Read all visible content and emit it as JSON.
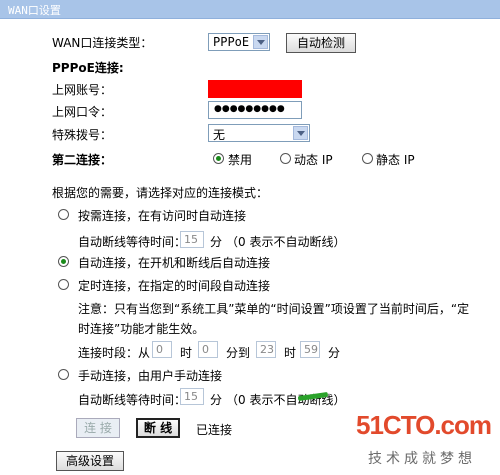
{
  "window": {
    "title": "WAN口设置"
  },
  "wan_type": {
    "label": "WAN口连接类型：",
    "value": "PPPoE",
    "detect_button": "自动检测"
  },
  "pppoe": {
    "section_label": "PPPoE连接:",
    "account_label": "上网账号：",
    "password_label": "上网口令：",
    "password_mask": "●●●●●●●●●",
    "dial_label": "特殊拨号：",
    "dial_value": "无"
  },
  "second": {
    "label": "第二连接：",
    "options": [
      "禁用",
      "动态 IP",
      "静态 IP"
    ],
    "selected_index": 0
  },
  "mode": {
    "prompt": "根据您的需要，请选择对应的连接模式：",
    "ondemand_label": "按需连接，在有访问时自动连接",
    "ondemand_idle_prefix": "自动断线等待时间：",
    "ondemand_idle_value": "15",
    "ondemand_idle_unit": "分",
    "ondemand_idle_note": "（0 表示不自动断线）",
    "auto_label": "自动连接，在开机和断线后自动连接",
    "timed_label": "定时连接，在指定的时间段自动连接",
    "timed_note_line1": "注意：只有当您到“系统工具”菜单的“时间设置”项设置了当前时间后，“定",
    "timed_note_line2": "时连接”功能才能生效。",
    "period_prefix": "连接时段：从",
    "from_hour": "0",
    "hour_unit_1": "时",
    "from_min": "0",
    "min_to": "分到",
    "to_hour": "23",
    "hour_unit_2": "时",
    "to_min": "59",
    "min_unit": "分",
    "manual_label": "手动连接，由用户手动连接",
    "manual_idle_prefix": "自动断线等待时间：",
    "manual_idle_value": "15",
    "manual_idle_unit": "分",
    "manual_idle_note": "（0 表示不自动断线）",
    "selected": "auto"
  },
  "actions": {
    "connect_button": "连 接",
    "disconnect_button": "断 线",
    "status": "已连接",
    "advanced_button": "高级设置"
  },
  "watermark": {
    "brand": "51CTO.com",
    "slogan": "技术成就梦想"
  },
  "colors": {
    "titlebar": "#a8c4e8",
    "redacted": "#ff0000",
    "radio_on": "#1a8a1a"
  }
}
